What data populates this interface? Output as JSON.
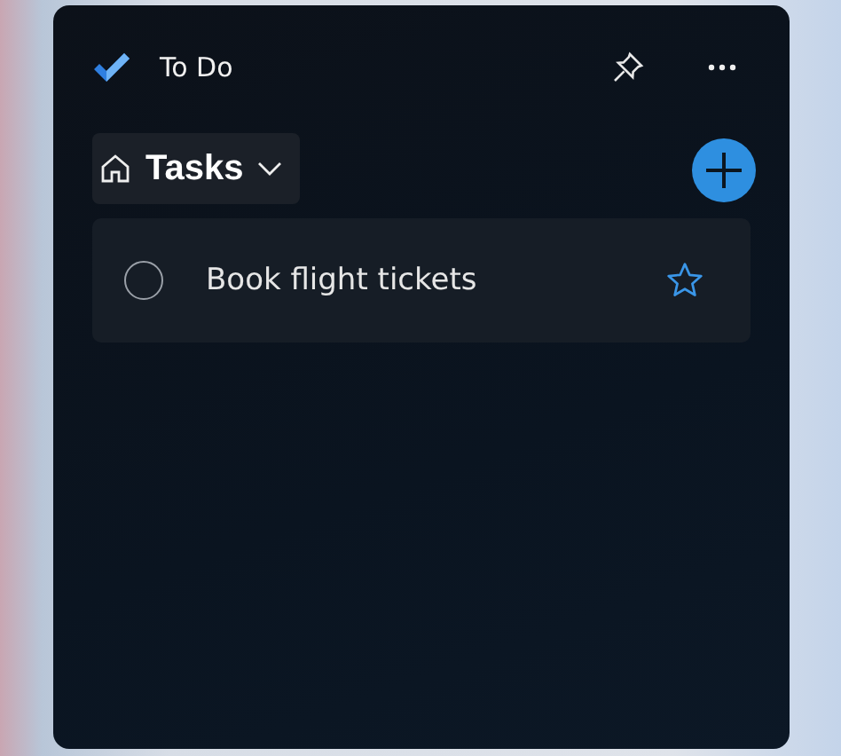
{
  "window": {
    "title": "To Do"
  },
  "list": {
    "title": "Tasks"
  },
  "tasks": [
    {
      "title": "Book flight tickets",
      "completed": false,
      "important": false
    }
  ]
}
